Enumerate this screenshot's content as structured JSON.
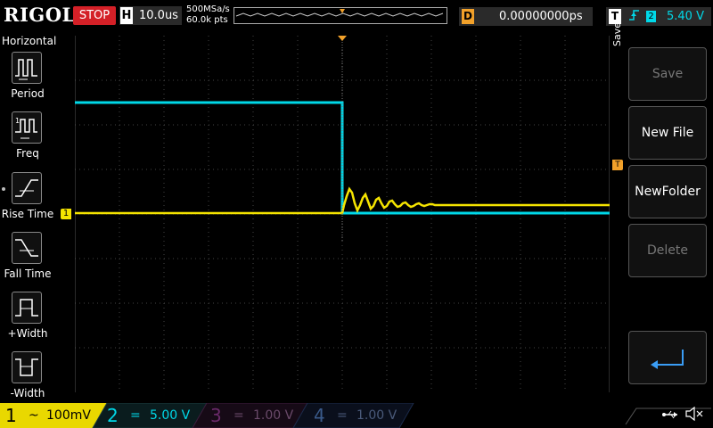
{
  "topbar": {
    "logo": "RIGOL",
    "run_state": "STOP",
    "horizontal_label": "H",
    "time_base": "10.0us",
    "sample_rate": "500MSa/s",
    "memory_points": "60.0k pts",
    "delay_label": "D",
    "delay_value": "0.00000000ps",
    "trigger_label": "T",
    "trigger_source": "2",
    "trigger_level": "5.40 V"
  },
  "left_menu": {
    "title": "Horizontal",
    "items": [
      {
        "label": "Period",
        "icon": "period-icon"
      },
      {
        "label": "Freq",
        "icon": "frequency-icon"
      },
      {
        "label": "Rise Time",
        "icon": "rise-time-icon"
      },
      {
        "label": "Fall Time",
        "icon": "fall-time-icon"
      },
      {
        "label": "+Width",
        "icon": "positive-width-icon"
      },
      {
        "label": "-Width",
        "icon": "negative-width-icon"
      }
    ]
  },
  "right_menu": {
    "title": "Save",
    "buttons": [
      {
        "label": "Save",
        "enabled": false
      },
      {
        "label": "New File",
        "enabled": true
      },
      {
        "label": "NewFolder",
        "enabled": true
      },
      {
        "label": "Delete",
        "enabled": false
      },
      {
        "label": "",
        "icon": "enter-arrow-icon",
        "enabled": true
      }
    ]
  },
  "markers": {
    "channel1": "1",
    "trigger": "T"
  },
  "channels": [
    {
      "number": "1",
      "coupling": "~",
      "scale": "100mV",
      "color": "#f5e400",
      "active": true
    },
    {
      "number": "2",
      "coupling": "=",
      "scale": "5.00 V",
      "color": "#00d8e8",
      "active": true
    },
    {
      "number": "3",
      "coupling": "=",
      "scale": "1.00 V",
      "color": "#d300d3",
      "active": false
    },
    {
      "number": "4",
      "coupling": "=",
      "scale": "1.00 V",
      "color": "#2d7df5",
      "active": false
    }
  ],
  "colors": {
    "ch1": "#f5e400",
    "ch2": "#00d8e8",
    "brand_red": "#d42027",
    "trigger_orange": "#f2a12a"
  }
}
